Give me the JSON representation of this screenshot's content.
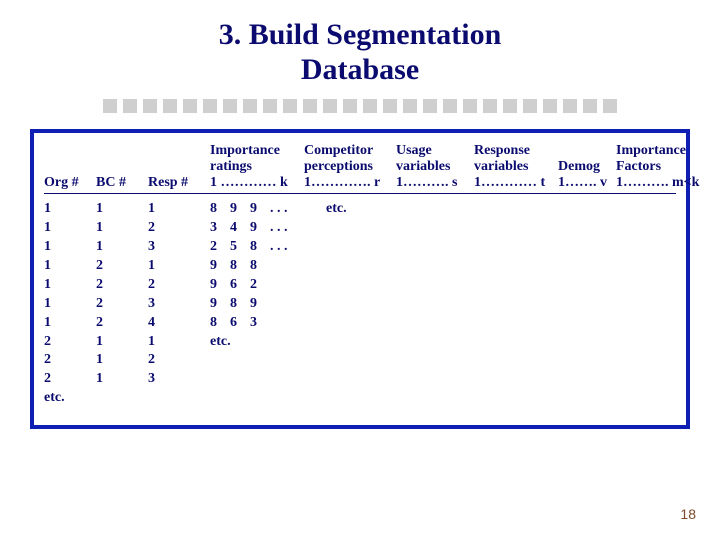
{
  "title_line1": "3. Build Segmentation",
  "title_line2": "Database",
  "divider_count": 26,
  "headers": {
    "org": {
      "l1": "",
      "l2": "",
      "l3": "Org #"
    },
    "bc": {
      "l1": "",
      "l2": "",
      "l3": "BC #"
    },
    "resp": {
      "l1": "",
      "l2": "",
      "l3": "Resp #"
    },
    "imp": {
      "l1": "Importance",
      "l2": "ratings",
      "l3": "1 ………… k"
    },
    "comp": {
      "l1": "Competitor",
      "l2": "perceptions",
      "l3": "1…………. r"
    },
    "usage": {
      "l1": "Usage",
      "l2": "variables",
      "l3": "1………. s"
    },
    "respv": {
      "l1": "Response",
      "l2": "variables",
      "l3": "1………… t"
    },
    "demog": {
      "l1": "",
      "l2": "Demog",
      "l3": "1……. v"
    },
    "impf": {
      "l1": "Importance",
      "l2": "Factors",
      "l3": "1………. m<k"
    }
  },
  "rows": {
    "org": [
      "1",
      "1",
      "1",
      "1",
      "1",
      "1",
      "1",
      "2",
      "2",
      "2",
      "etc."
    ],
    "bc": [
      "1",
      "1",
      "1",
      "2",
      "2",
      "2",
      "2",
      "1",
      "1",
      "1"
    ],
    "resp": [
      "1",
      "2",
      "3",
      "1",
      "2",
      "3",
      "4",
      "1",
      "2",
      "3"
    ]
  },
  "ratings": {
    "c1": [
      "8",
      "3",
      "2",
      "9",
      "9",
      "9",
      "8",
      "etc."
    ],
    "c2": [
      "9",
      "4",
      "5",
      "8",
      "6",
      "8",
      "6"
    ],
    "c3": [
      "9",
      "9",
      "8",
      "8",
      "2",
      "9",
      "3"
    ]
  },
  "dots": [
    ". . .",
    ". . .",
    ". . ."
  ],
  "ratings_etc": "etc.",
  "page_number": "18"
}
